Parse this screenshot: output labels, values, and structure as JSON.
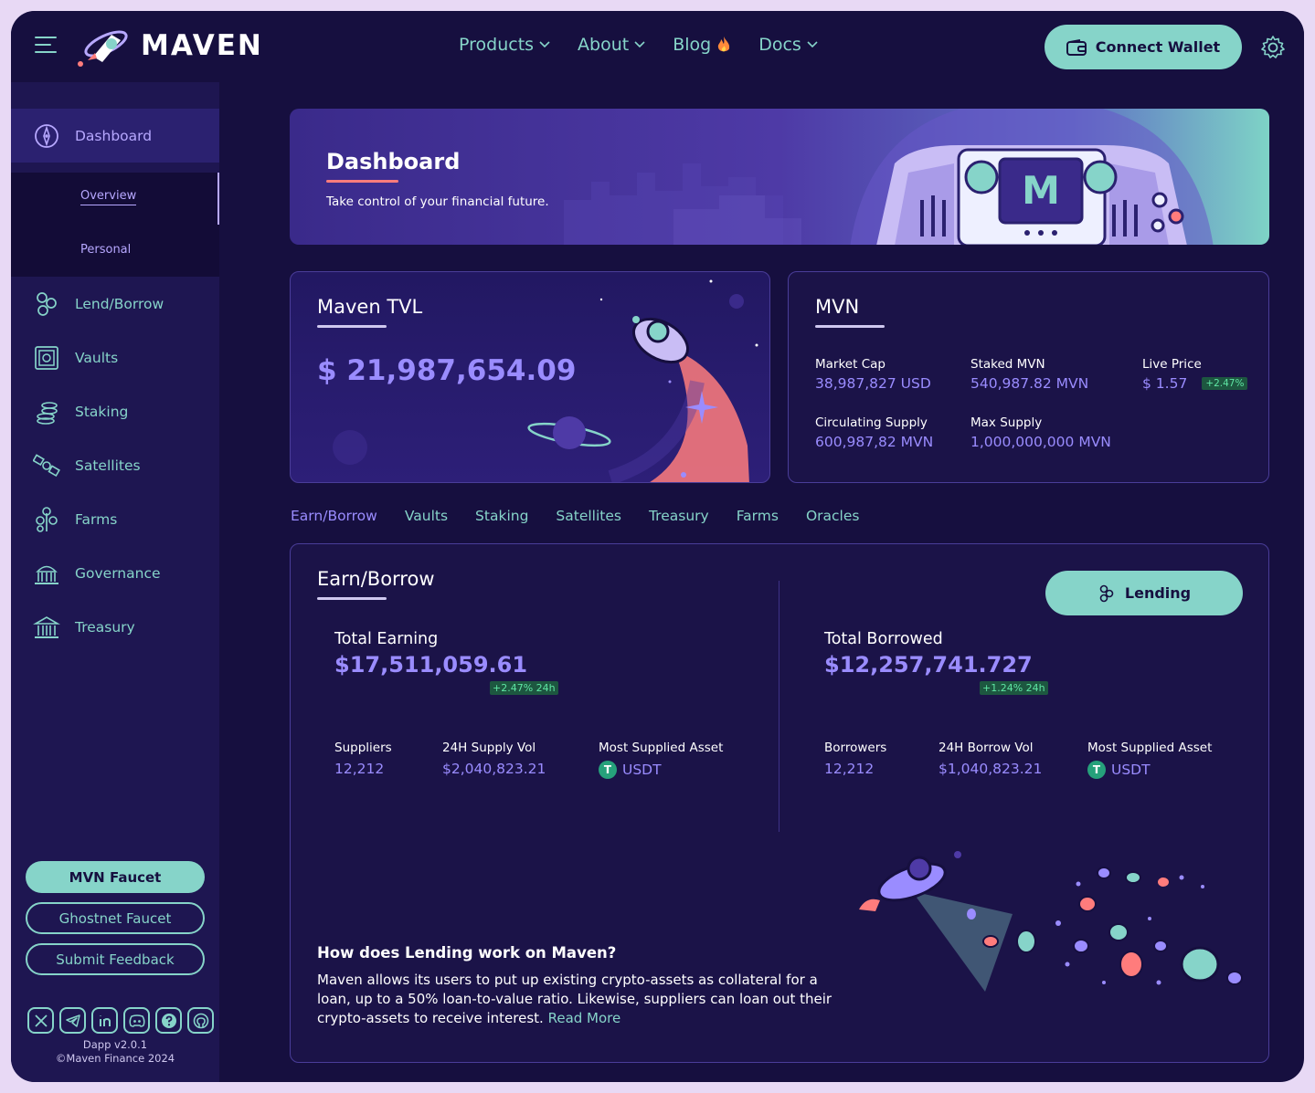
{
  "header": {
    "logo_text": "MAVEN",
    "nav": [
      {
        "label": "Products",
        "dropdown": true
      },
      {
        "label": "About",
        "dropdown": true
      },
      {
        "label": "Blog",
        "icon": "fire-icon"
      },
      {
        "label": "Docs",
        "dropdown": true
      }
    ],
    "connect_label": "Connect Wallet"
  },
  "sidebar": {
    "items": [
      {
        "label": "Dashboard",
        "icon": "compass-icon",
        "active": true
      },
      {
        "label": "Lend/Borrow",
        "icon": "coins-icon"
      },
      {
        "label": "Vaults",
        "icon": "vault-icon"
      },
      {
        "label": "Staking",
        "icon": "stack-icon"
      },
      {
        "label": "Satellites",
        "icon": "satellite-icon"
      },
      {
        "label": "Farms",
        "icon": "farm-icon"
      },
      {
        "label": "Governance",
        "icon": "capitol-icon"
      },
      {
        "label": "Treasury",
        "icon": "bank-icon"
      }
    ],
    "sub_items": [
      {
        "label": "Overview",
        "active": true
      },
      {
        "label": "Personal"
      }
    ],
    "buttons": {
      "faucet": "MVN Faucet",
      "ghostnet": "Ghostnet Faucet",
      "feedback": "Submit Feedback"
    },
    "socials": [
      "x-icon",
      "telegram-icon",
      "linkedin-icon",
      "discord-icon",
      "help-icon",
      "github-icon"
    ],
    "version": "Dapp v2.0.1",
    "copyright": "©Maven Finance 2024"
  },
  "hero": {
    "title": "Dashboard",
    "subtitle": "Take control of your financial future."
  },
  "tvl": {
    "title": "Maven TVL",
    "value": "$ 21,987,654.09"
  },
  "mvn": {
    "title": "MVN",
    "market_cap_label": "Market Cap",
    "market_cap": "38,987,827 USD",
    "staked_label": "Staked MVN",
    "staked": "540,987.82 MVN",
    "price_label": "Live Price",
    "price": "$ 1.57",
    "price_change": "+2.47%",
    "circ_label": "Circulating Supply",
    "circ": "600,987,82 MVN",
    "max_label": "Max Supply",
    "max": "1,000,000,000 MVN"
  },
  "tabs": [
    "Earn/Borrow",
    "Vaults",
    "Staking",
    "Satellites",
    "Treasury",
    "Farms",
    "Oracles"
  ],
  "earn": {
    "title": "Earn/Borrow",
    "lend_label": "Lending",
    "earning_label": "Total Earning",
    "earning": "$17,511,059.61",
    "earning_change": "+2.47% 24h",
    "borrowed_label": "Total Borrowed",
    "borrowed": "$12,257,741.727",
    "borrowed_change": "+1.24% 24h",
    "suppliers_label": "Suppliers",
    "suppliers": "12,212",
    "supply_vol_label": "24H Supply Vol",
    "supply_vol": "$2,040,823.21",
    "most_supplied_label": "Most Supplied Asset",
    "most_supplied": "USDT",
    "borrowers_label": "Borrowers",
    "borrowers": "12,212",
    "borrow_vol_label": "24H Borrow Vol",
    "borrow_vol": "$1,040,823.21",
    "most_supplied_label_2": "Most Supplied Asset",
    "most_supplied_2": "USDT",
    "faq_title": "How does Lending work on Maven?",
    "faq_body": "Maven allows its users to put up existing crypto-assets as collateral for a loan, up to a 50% loan-to-value ratio. Likewise, suppliers can loan out their crypto-assets to receive interest.",
    "read_more": "Read More"
  },
  "colors": {
    "bg": "#160f3f",
    "accent": "#86d4c9",
    "purple": "#9a8cff",
    "positive": "#5fe6a4"
  }
}
